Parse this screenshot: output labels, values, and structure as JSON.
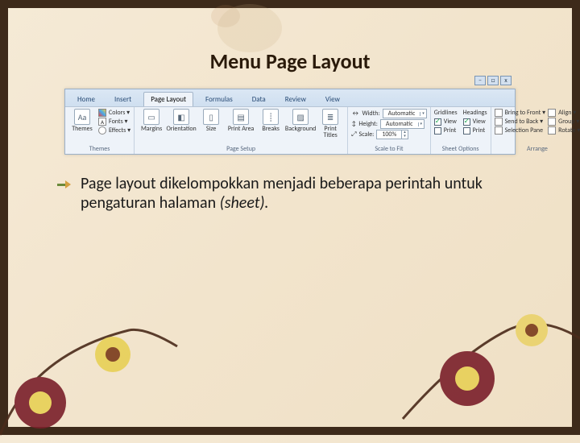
{
  "slide": {
    "title": "Menu Page Layout",
    "body_text": "Page layout dikelompokkan menjadi beberapa perintah untuk pengaturan halaman ",
    "body_text_em": "(sheet)."
  },
  "ribbon": {
    "tabs": {
      "home": "Home",
      "insert": "Insert",
      "page_layout": "Page Layout",
      "formulas": "Formulas",
      "data": "Data",
      "review": "Review",
      "view": "View"
    },
    "window": {
      "min": "–",
      "max": "□",
      "close": "x"
    },
    "themes": {
      "label": "Themes",
      "themes_btn": "Themes",
      "colors": "Colors ▾",
      "fonts": "Fonts ▾",
      "effects": "Effects ▾"
    },
    "page_setup": {
      "label": "Page Setup",
      "margins": "Margins",
      "orientation": "Orientation",
      "size": "Size",
      "print_area": "Print Area",
      "breaks": "Breaks",
      "background": "Background",
      "print_titles": "Print Titles"
    },
    "scale": {
      "label": "Scale to Fit",
      "width_lbl": "Width:",
      "width_val": "Automatic",
      "height_lbl": "Height:",
      "height_val": "Automatic",
      "scale_lbl": "Scale:",
      "scale_val": "100%"
    },
    "sheet_options": {
      "label": "Sheet Options",
      "gridlines": "Gridlines",
      "headings": "Headings",
      "view": "View",
      "print": "Print"
    },
    "arrange": {
      "label": "Arrange",
      "bring_front": "Bring to Front ▾",
      "send_back": "Send to Back ▾",
      "selection_pane": "Selection Pane",
      "align": "Align ▾",
      "group": "Group ▾",
      "rotate": "Rotate ▾"
    }
  }
}
